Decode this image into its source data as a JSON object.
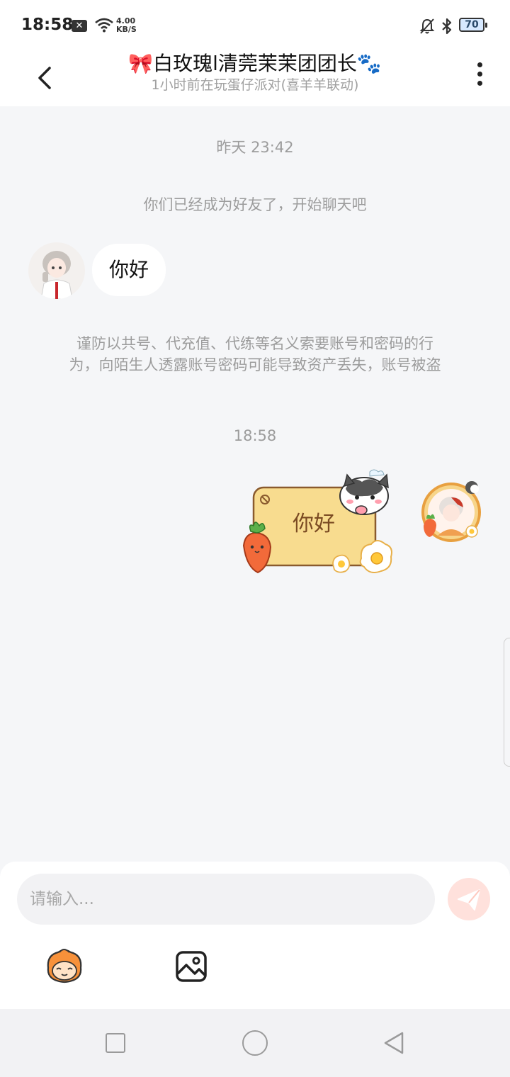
{
  "status_bar": {
    "time": "18:58",
    "net_speed_value": "4.00",
    "net_speed_unit": "KB/S",
    "battery": "70"
  },
  "header": {
    "title_prefix_emoji": "🎀",
    "title": "白玫瑰l清莞茉茉团团长",
    "title_suffix_emoji": "🐾",
    "subtitle": "1小时前在玩蛋仔派对(喜羊羊联动)"
  },
  "chat": {
    "timestamp_1": "昨天 23:42",
    "system_message": "你们已经成为好友了，开始聊天吧",
    "incoming_message": "你好",
    "warning_line_1": "谨防以共号、代充值、代练等名义索要账号和密码的行",
    "warning_line_2": "为，向陌生人透露账号密码可能导致资产丢失，账号被盗",
    "timestamp_2": "18:58",
    "outgoing_sticker_text": "你好"
  },
  "composer": {
    "placeholder": "请输入..."
  },
  "icons": {
    "back": "chevron-left-icon",
    "more": "more-vertical-icon",
    "send": "paper-plane-icon",
    "emoji": "emoji-character-icon",
    "image": "image-icon"
  },
  "colors": {
    "background": "#f5f6f8",
    "send_button": "#ffe1dc",
    "sticker_card": "#f8dc8f"
  }
}
